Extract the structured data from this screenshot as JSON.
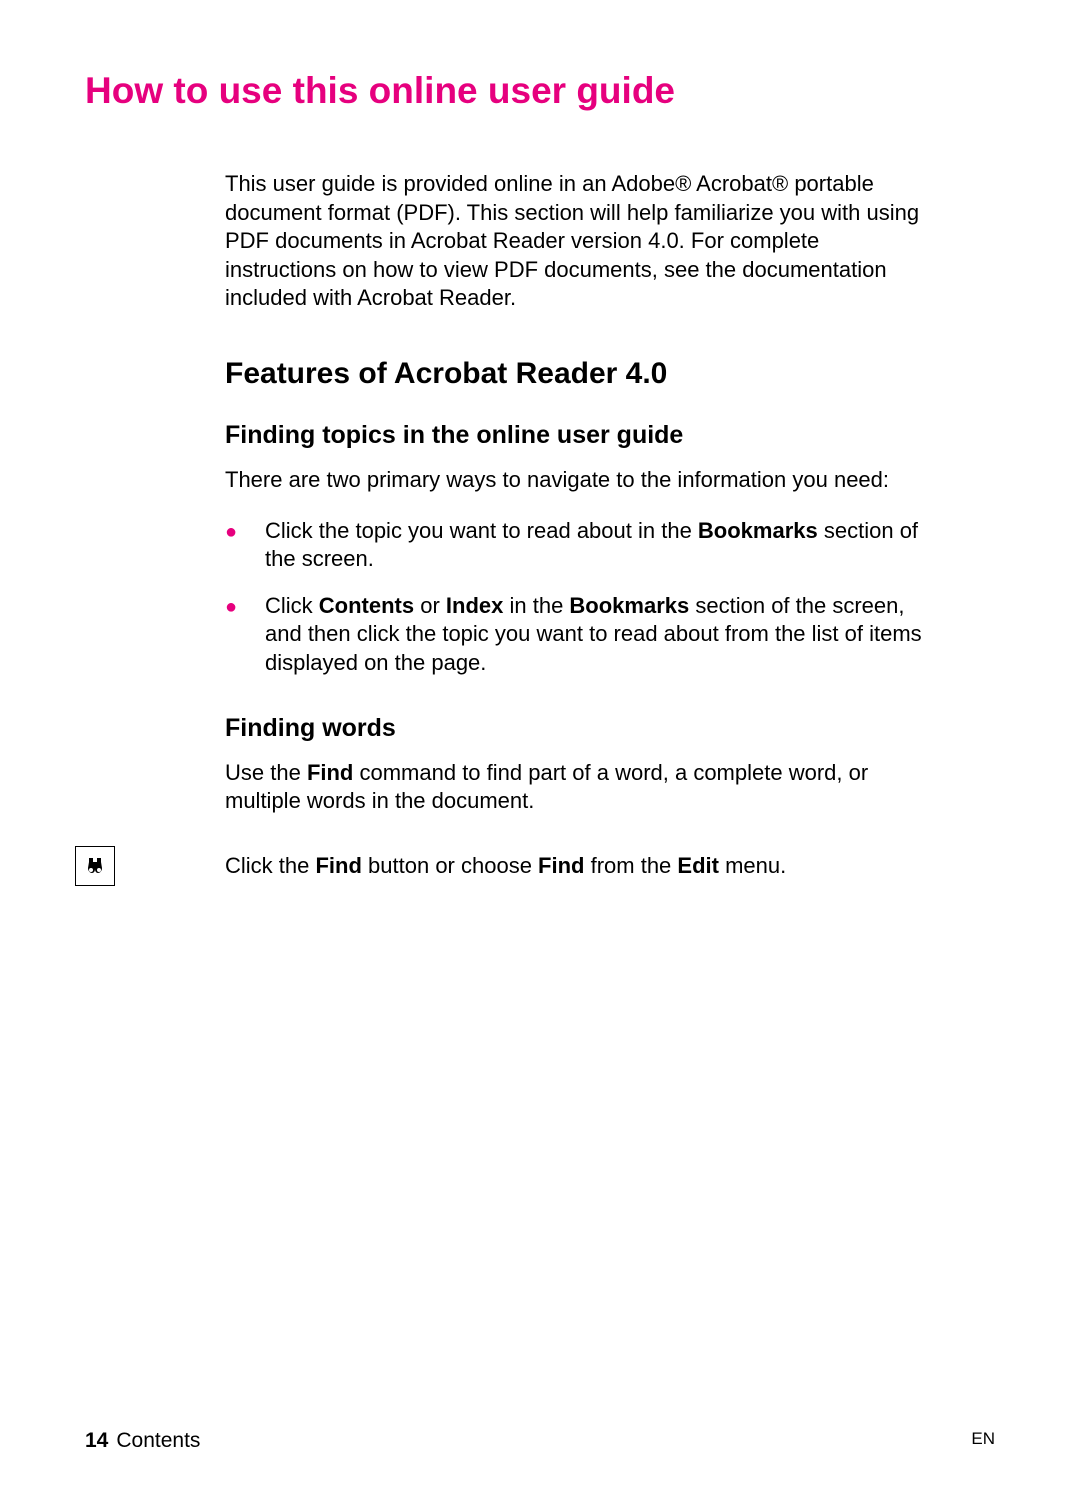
{
  "title": "How to use this online user guide",
  "intro": "This user guide is provided online in an Adobe® Acrobat® portable document format (PDF). This section will help familiarize you with using PDF documents in Acrobat Reader version 4.0. For complete instructions on how to view PDF documents, see the documentation included with Acrobat Reader.",
  "section_heading": "Features of Acrobat Reader 4.0",
  "subsection1": {
    "heading": "Finding topics in the online user guide",
    "intro": "There are two primary ways to navigate to the information you need:",
    "bullets": {
      "b1_pre": "Click the topic you want to read about in the ",
      "b1_bold": "Bookmarks",
      "b1_post": " section of the screen.",
      "b2_pre": "Click ",
      "b2_bold1": "Contents",
      "b2_mid1": " or ",
      "b2_bold2": "Index",
      "b2_mid2": " in the ",
      "b2_bold3": "Bookmarks",
      "b2_post": " section of the screen, and then click the topic you want to read about from the list of items displayed on the page."
    }
  },
  "subsection2": {
    "heading": "Finding words",
    "text_pre": "Use the ",
    "text_bold": "Find",
    "text_post": " command to find part of a word, a complete word, or multiple words in the document.",
    "find_pre": "Click the ",
    "find_bold1": "Find",
    "find_mid1": " button or choose ",
    "find_bold2": "Find",
    "find_mid2": " from the ",
    "find_bold3": "Edit",
    "find_post": " menu."
  },
  "footer": {
    "page_number": "14",
    "section_label": "Contents",
    "lang": "EN"
  }
}
